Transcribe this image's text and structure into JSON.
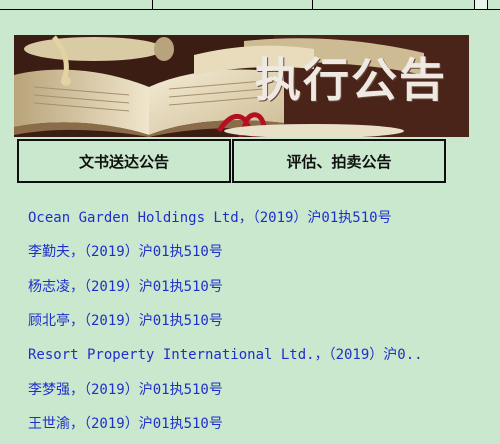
{
  "banner": {
    "title": "执行公告"
  },
  "tabs": [
    {
      "label": "文书送达公告"
    },
    {
      "label": "评估、拍卖公告"
    }
  ],
  "notices": [
    {
      "text": "Ocean Garden Holdings Ltd，（2019）沪01执510号"
    },
    {
      "text": "李勤夫，（2019）沪01执510号"
    },
    {
      "text": "杨志凌，（2019）沪01执510号"
    },
    {
      "text": "顾北亭，（2019）沪01执510号"
    },
    {
      "text": "Resort Property International Ltd.，（2019）沪0.."
    },
    {
      "text": "李梦强，（2019）沪01执510号"
    },
    {
      "text": "王世渝，（2019）沪01执510号"
    }
  ]
}
